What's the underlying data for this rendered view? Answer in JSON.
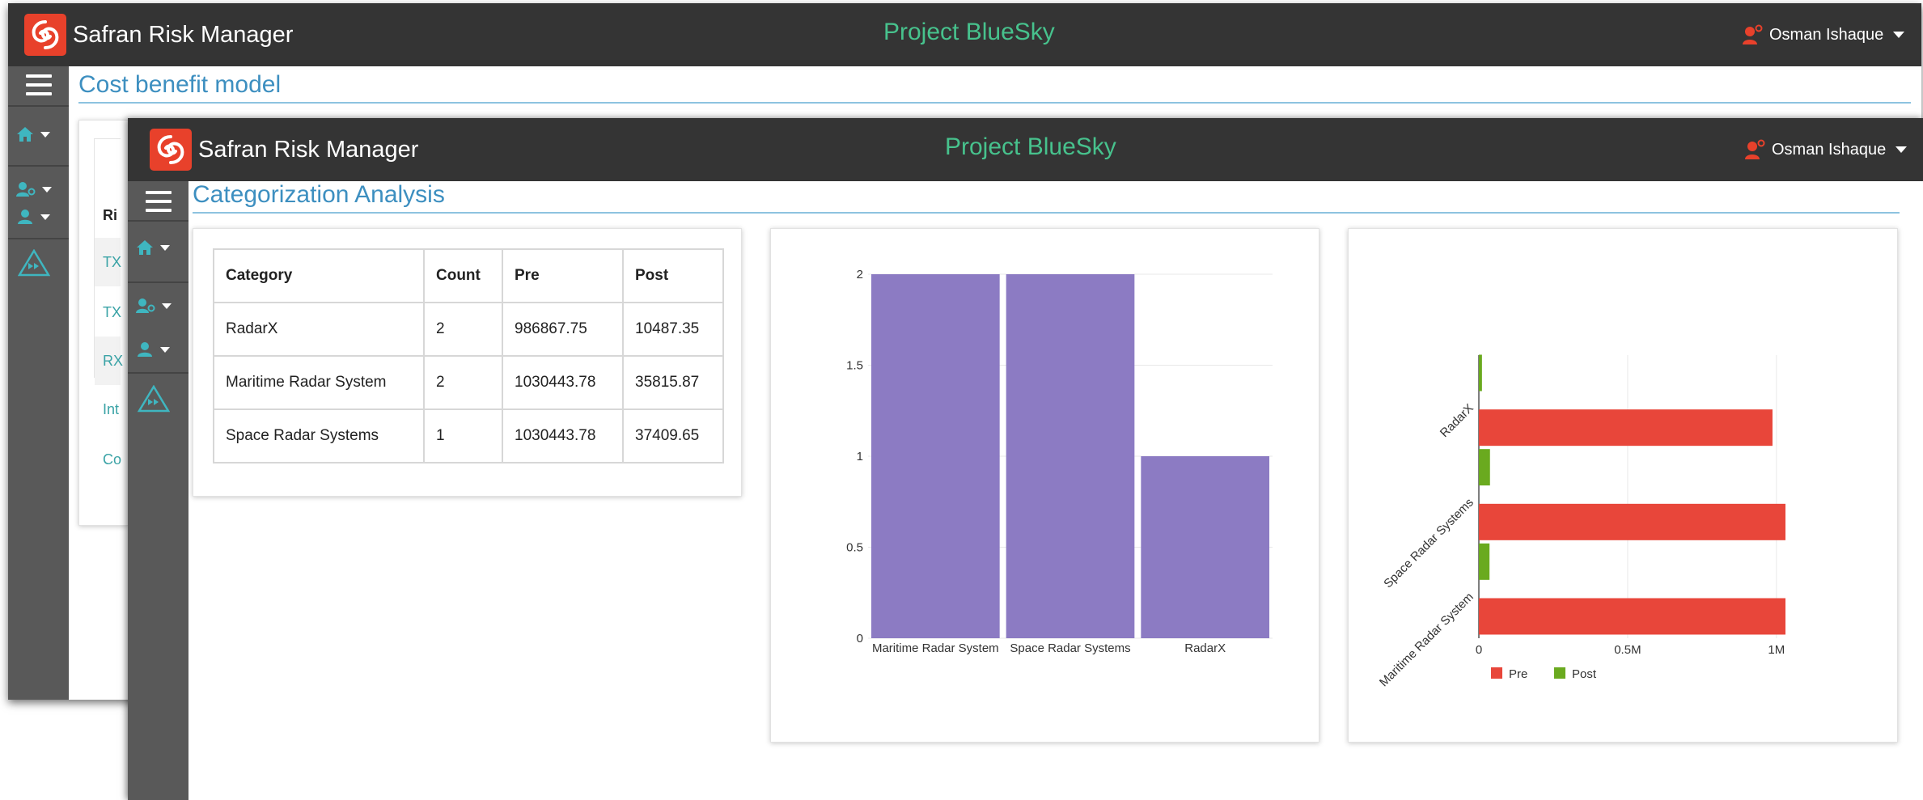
{
  "app": {
    "brand": "Safran Risk Manager",
    "project": "Project BlueSky",
    "user": "Osman Ishaque"
  },
  "back_window": {
    "page_title": "Cost benefit model",
    "table_fragment": [
      "Ri",
      "TX",
      "TX",
      "RX",
      "Int",
      "Co"
    ]
  },
  "front_window": {
    "page_title": "Categorization Analysis",
    "table": {
      "headers": [
        "Category",
        "Count",
        "Pre",
        "Post"
      ],
      "rows": [
        [
          "RadarX",
          "2",
          "986867.75",
          "10487.35"
        ],
        [
          "Maritime Radar System",
          "2",
          "1030443.78",
          "35815.87"
        ],
        [
          "Space Radar Systems",
          "1",
          "1030443.78",
          "37409.65"
        ]
      ]
    }
  },
  "icons": {
    "menu": "hamburger-icon",
    "home": "home-icon",
    "user_settings": "user-settings-icon",
    "users": "users-icon",
    "triangle": "forward-triangle-icon",
    "user_alert": "user-alert-icon"
  },
  "colors": {
    "topbar": "#343434",
    "sidebar": "#595959",
    "project": "#47c28d",
    "accent": "#3d8fc0",
    "brand_red": "#e8412b",
    "bar": "#8c7bc3",
    "pre": "#e8463a",
    "post": "#6aaa1f"
  },
  "chart_data": [
    {
      "type": "bar",
      "categories": [
        "Maritime Radar System",
        "Space Radar Systems",
        "RadarX"
      ],
      "values": [
        2,
        2,
        1
      ],
      "ylim": [
        0,
        2
      ],
      "yticks": [
        "0",
        "0.5",
        "1",
        "1.5",
        "2"
      ],
      "grid": true
    },
    {
      "type": "bar",
      "orientation": "horizontal",
      "categories": [
        "Maritime Radar System",
        "Space Radar Systems",
        "RadarX"
      ],
      "series": [
        {
          "name": "Pre",
          "values": [
            1030443.78,
            1030443.78,
            986867.75
          ]
        },
        {
          "name": "Post",
          "values": [
            35815.87,
            37409.65,
            10487.35
          ]
        }
      ],
      "xlim": [
        0,
        1030443.78
      ],
      "xticks": [
        "0",
        "0.5M",
        "1M"
      ],
      "legend": "bottom-left",
      "grid": true
    }
  ]
}
